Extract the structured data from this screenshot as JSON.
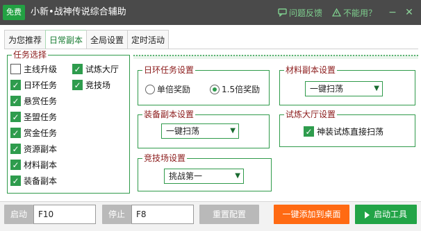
{
  "titlebar": {
    "badge": "免费",
    "title": "小新•战神传说综合辅助",
    "feedback": "问题反馈",
    "cannot_use": "不能用？",
    "minimize": "−",
    "close": "✕"
  },
  "tabs": [
    "为您推荐",
    "日常副本",
    "全局设置",
    "定时活动"
  ],
  "active_tab": "日常副本",
  "task_group": {
    "legend": "任务选择",
    "items": [
      {
        "label": "主线升级",
        "checked": false
      },
      {
        "label": "试炼大厅",
        "checked": true
      },
      {
        "label": "日环任务",
        "checked": true
      },
      {
        "label": "竞技场",
        "checked": true
      },
      {
        "label": "悬赏任务",
        "checked": true
      },
      {
        "label": "圣盟任务",
        "checked": true
      },
      {
        "label": "赏金任务",
        "checked": true
      },
      {
        "label": "资源副本",
        "checked": true
      },
      {
        "label": "材料副本",
        "checked": true
      },
      {
        "label": "装备副本",
        "checked": true
      }
    ]
  },
  "daily_ring": {
    "legend": "日环任务设置",
    "option_single": "单倍奖励",
    "option_double": "1.5倍奖励",
    "selected": "1.5倍奖励"
  },
  "material_dungeon": {
    "legend": "材料副本设置",
    "value": "一键扫荡"
  },
  "equip_dungeon": {
    "legend": "装备副本设置",
    "value": "一键扫荡"
  },
  "trial_hall": {
    "legend": "试炼大厅设置",
    "option": "神装试炼直接扫荡",
    "checked": true
  },
  "arena": {
    "legend": "竞技场设置",
    "value": "挑战第一"
  },
  "bottom": {
    "start_label": "启动",
    "start_hotkey": "F10",
    "stop_label": "停止",
    "stop_hotkey": "F8",
    "reset": "重置配置",
    "add_desktop": "一键添加到桌面",
    "launch": "启动工具"
  },
  "colors": {
    "accent_green": "#22a447",
    "orange": "#ff6a13",
    "titlebar": "#4a4a4a",
    "legend_text": "#8b1a1a"
  }
}
